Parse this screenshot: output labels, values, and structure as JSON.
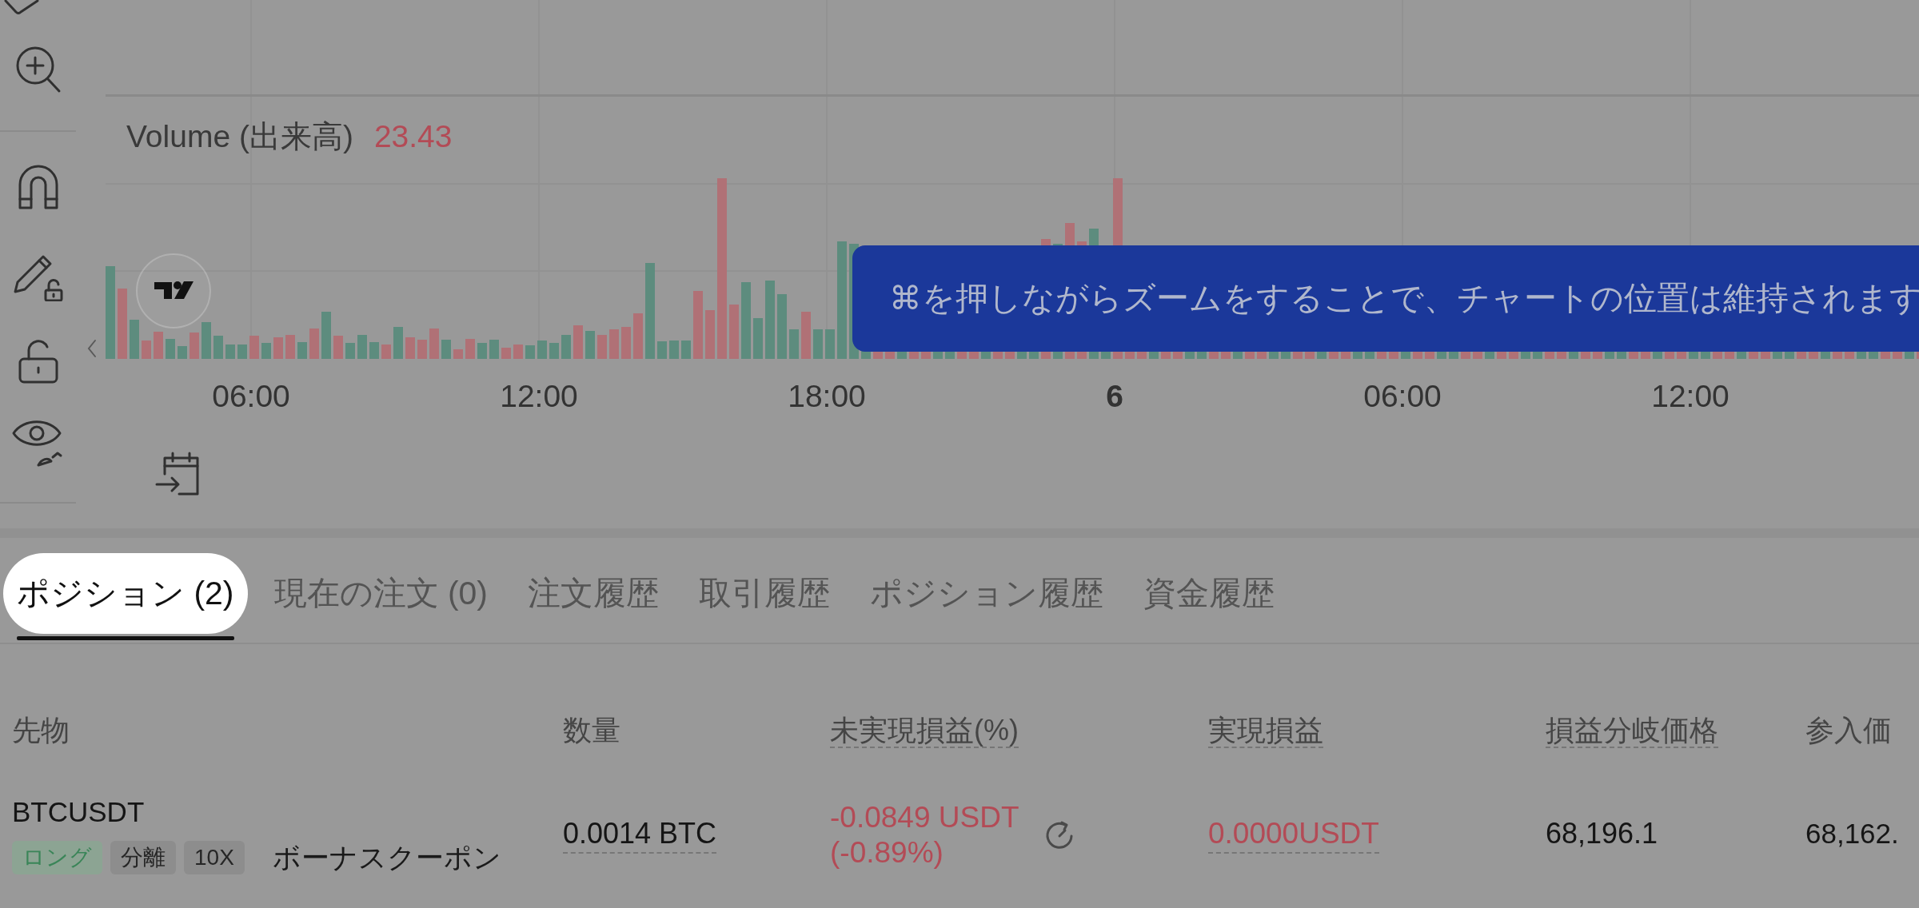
{
  "chart": {
    "volume_label": "Volume (出来高)",
    "volume_value": "23.43",
    "volume_rising": false,
    "time_axis": [
      {
        "label": "06:00",
        "kind": "time"
      },
      {
        "label": "12:00",
        "kind": "time"
      },
      {
        "label": "18:00",
        "kind": "time"
      },
      {
        "label": "6",
        "kind": "day"
      },
      {
        "label": "06:00",
        "kind": "time"
      },
      {
        "label": "12:00",
        "kind": "time"
      }
    ]
  },
  "hint": {
    "text": "⌘を押しながらズームをすることで、チャートの位置は維持されます"
  },
  "tabs": [
    {
      "label": "ポジション (2)",
      "selected": true,
      "spotlight": true
    },
    {
      "label": "現在の注文 (0)",
      "selected": false,
      "spotlight": false
    },
    {
      "label": "注文履歴",
      "selected": false,
      "spotlight": false
    },
    {
      "label": "取引履歴",
      "selected": false,
      "spotlight": false
    },
    {
      "label": "ポジション履歴",
      "selected": false,
      "spotlight": false
    },
    {
      "label": "資金履歴",
      "selected": false,
      "spotlight": false
    }
  ],
  "positions_table": {
    "columns": [
      {
        "label": "先物",
        "underlined": false
      },
      {
        "label": "数量",
        "underlined": false
      },
      {
        "label": "未実現損益(%)",
        "underlined": true
      },
      {
        "label": "実現損益",
        "underlined": true
      },
      {
        "label": "損益分岐価格",
        "underlined": true
      },
      {
        "label": "参入価",
        "underlined": false
      }
    ],
    "rows": [
      {
        "symbol": "BTCUSDT",
        "tags": [
          {
            "label": "ロング",
            "kind": "side"
          },
          {
            "label": "分離",
            "kind": "info"
          },
          {
            "label": "10X",
            "kind": "info"
          }
        ],
        "bonus": "ボーナスクーポン",
        "quantity": "0.0014 BTC",
        "unrealized_pnl": "-0.0849 USDT",
        "unrealized_pnl_pct": "(-0.89%)",
        "realized_pnl": "0.0000USDT",
        "break_even_price": "68,196.1",
        "entry_price": "68,162.",
        "pnl_negative": true
      }
    ]
  }
}
